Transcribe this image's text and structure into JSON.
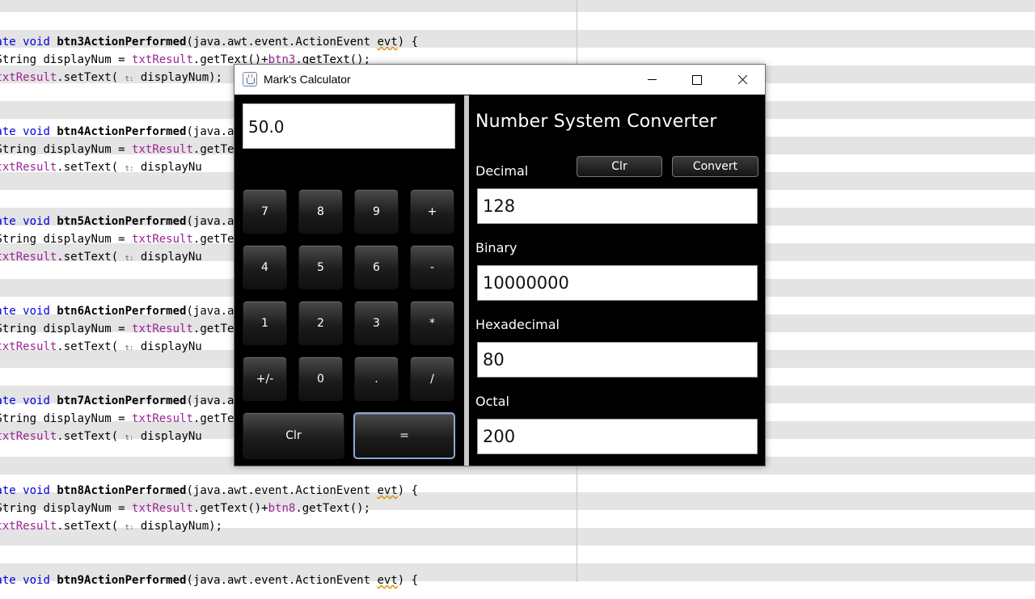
{
  "editor": {
    "blocks": [
      {
        "method": "btn3ActionPerformed",
        "btn": "btn3",
        "full": true
      },
      {
        "method": "btn4ActionPerformed",
        "btn": "btn4",
        "full": false
      },
      {
        "method": "btn5ActionPerformed",
        "btn": "btn5",
        "full": false
      },
      {
        "method": "btn6ActionPerformed",
        "btn": "btn6",
        "full": false
      },
      {
        "method": "btn7ActionPerformed",
        "btn": "btn7",
        "full": false
      },
      {
        "method": "btn8ActionPerformed",
        "btn": "btn8",
        "full": true
      },
      {
        "method": "btn9ActionPerformed",
        "btn": "btn9",
        "full": true
      }
    ],
    "kw_prefix": "vate",
    "kw_void": "void",
    "params": "(java.awt.event.ActionEvent ",
    "evt": "evt",
    "params_end": ") {",
    "decl_type": "String",
    "decl_var": " displayNum = ",
    "field": "txtResult",
    "get_text": ".getText()+",
    "get_text_end": ".getText();",
    "set_text": ".setText(",
    "hint": "t:",
    "set_arg": "displayNum);",
    "cut_text": "displayNu"
  },
  "window": {
    "title": "Mark's Calculator"
  },
  "calculator": {
    "display_value": "50.0",
    "keys": [
      "7",
      "8",
      "9",
      "+",
      "4",
      "5",
      "6",
      "-",
      "1",
      "2",
      "3",
      "*",
      "+/-",
      "0",
      ".",
      "/"
    ],
    "clear_label": "Clr",
    "equals_label": "="
  },
  "converter": {
    "title": "Number System Converter",
    "clear_label": "Clr",
    "convert_label": "Convert",
    "decimal_label": "Decimal",
    "decimal_value": "128",
    "binary_label": "Binary",
    "binary_value": "10000000",
    "hex_label": "Hexadecimal",
    "hex_value": "80",
    "octal_label": "Octal",
    "octal_value": "200"
  }
}
